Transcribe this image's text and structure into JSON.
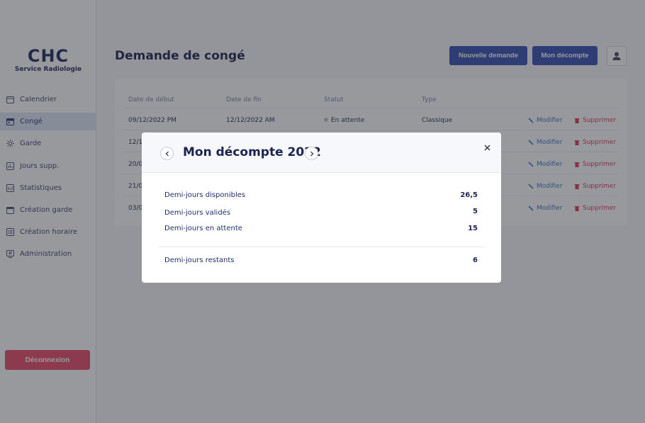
{
  "brand": {
    "mark": "CHC",
    "subtitle": "Service Radiologie"
  },
  "sidebar": {
    "items": [
      {
        "label": "Calendrier",
        "icon": "calendar-icon",
        "active": false
      },
      {
        "label": "Congé",
        "icon": "calendar-leave-icon",
        "active": true
      },
      {
        "label": "Garde",
        "icon": "sun-icon",
        "active": false
      },
      {
        "label": "Jours supp.",
        "icon": "chart-icon",
        "active": false
      },
      {
        "label": "Statistiques",
        "icon": "stats-icon",
        "active": false
      },
      {
        "label": "Création garde",
        "icon": "calendar-plus-icon",
        "active": false
      },
      {
        "label": "Création horaire",
        "icon": "schedule-icon",
        "active": false
      },
      {
        "label": "Administration",
        "icon": "admin-icon",
        "active": false
      }
    ],
    "logout_label": "Déconnexion"
  },
  "header": {
    "title": "Demande de congé",
    "new_request_label": "Nouvelle demande",
    "my_count_label": "Mon décompte"
  },
  "table": {
    "headers": [
      "Date de début",
      "Date de fin",
      "Statut",
      "Type"
    ],
    "rows": [
      {
        "start": "09/12/2022 PM",
        "end": "12/12/2022 AM",
        "status": "En attente",
        "type": "Classique"
      },
      {
        "start": "12/1"
      },
      {
        "start": "20/0"
      },
      {
        "start": "21/0"
      },
      {
        "start": "03/0"
      }
    ],
    "edit_label": "Modifier",
    "delete_label": "Supprimer"
  },
  "modal": {
    "title": "Mon décompte 2022",
    "stats": [
      {
        "label": "Demi-jours disponibles",
        "value": "26,5"
      },
      {
        "label": "Demi-jours validés",
        "value": "5"
      },
      {
        "label": "Demi-jours en attente",
        "value": "15"
      }
    ],
    "remaining": {
      "label": "Demi-jours restants",
      "value": "6"
    }
  },
  "colors": {
    "primary": "#3550b0",
    "danger": "#e64b67",
    "link": "#3a74c4",
    "active_nav": "#dfe8f5"
  }
}
